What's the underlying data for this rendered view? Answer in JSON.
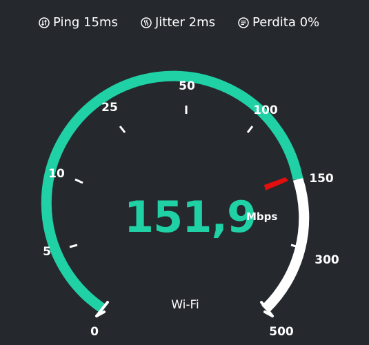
{
  "stats": {
    "ping": {
      "label": "Ping 15ms",
      "icon": "ping-icon"
    },
    "jitter": {
      "label": "Jitter 2ms",
      "icon": "jitter-icon"
    },
    "loss": {
      "label": "Perdita 0%",
      "icon": "packet-loss-icon"
    }
  },
  "gauge": {
    "scale_labels": [
      "0",
      "5",
      "10",
      "25",
      "50",
      "100",
      "150",
      "300",
      "500"
    ],
    "current_speed": 151.9,
    "current_speed_text": "151,9",
    "unit": "Mbps",
    "connection": "Wi-Fi",
    "colors": {
      "accent": "#1fd1a5",
      "remaining": "#ffffff",
      "needle": "#e30f0f",
      "background": "#25292e"
    }
  }
}
